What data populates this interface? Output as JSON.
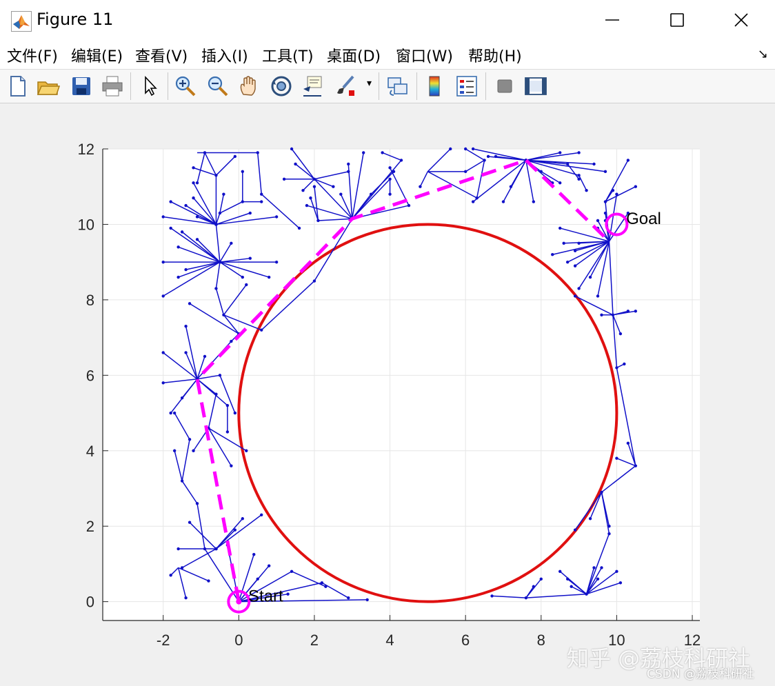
{
  "window": {
    "title": "Figure 11",
    "controls": {
      "minimize": "minimize-icon",
      "maximize": "maximize-icon",
      "close": "close-icon"
    }
  },
  "menu": [
    "文件(F)",
    "编辑(E)",
    "查看(V)",
    "插入(I)",
    "工具(T)",
    "桌面(D)",
    "窗口(W)",
    "帮助(H)"
  ],
  "toolbar": [
    "new-figure-icon",
    "open-file-icon",
    "save-icon",
    "print-icon",
    "pointer-icon",
    "zoom-in-icon",
    "zoom-out-icon",
    "pan-icon",
    "rotate-3d-icon",
    "data-cursor-icon",
    "brush-icon",
    "link-plot-icon",
    "colorbar-icon",
    "legend-icon",
    "hide-plot-tools-icon",
    "show-plot-tools-icon"
  ],
  "colors": {
    "tree": "#1010c8",
    "path": "#ff00ff",
    "obstacle": "#e01010",
    "grid": "#e6e6e6"
  },
  "chart_data": {
    "type": "line",
    "xlim": [
      -3.6,
      12.2
    ],
    "ylim": [
      -0.5,
      12
    ],
    "xticks": [
      "-2",
      "0",
      "2",
      "4",
      "6",
      "8",
      "10",
      "12"
    ],
    "yticks": [
      "0",
      "2",
      "4",
      "6",
      "8",
      "10",
      "12"
    ],
    "grid": true,
    "annotations": [
      {
        "text": "Start",
        "x": 0.25,
        "y": 0.15
      },
      {
        "text": "Goal",
        "x": 10.25,
        "y": 10.15
      }
    ],
    "start": {
      "x": 0,
      "y": 0
    },
    "goal": {
      "x": 10,
      "y": 10
    },
    "obstacle_circle": {
      "cx": 5,
      "cy": 5,
      "r": 5
    },
    "path": [
      {
        "x": 0,
        "y": 0
      },
      {
        "x": -1.1,
        "y": 5.9
      },
      {
        "x": 3.0,
        "y": 10.15
      },
      {
        "x": 7.6,
        "y": 11.7
      },
      {
        "x": 9.8,
        "y": 9.55
      }
    ],
    "tree_edges": [
      [
        0,
        0,
        -0.9,
        1.4
      ],
      [
        0,
        0,
        0.5,
        0.6
      ],
      [
        0,
        0,
        0.8,
        0.95
      ],
      [
        0,
        0,
        1.4,
        0.8
      ],
      [
        0,
        0,
        2.2,
        0.5
      ],
      [
        0,
        0,
        3.4,
        0.05
      ],
      [
        0,
        0,
        1.3,
        0.2
      ],
      [
        0,
        0,
        0.4,
        1.25
      ],
      [
        0,
        0,
        -0.3,
        1.5
      ],
      [
        1.4,
        0.8,
        2.3,
        0.4
      ],
      [
        2.2,
        0.5,
        2.9,
        0.1
      ],
      [
        -0.6,
        1.4,
        -1.5,
        0.9
      ],
      [
        -0.6,
        1.4,
        -1.3,
        2.1
      ],
      [
        -0.6,
        1.4,
        -1.6,
        1.4
      ],
      [
        -0.6,
        1.4,
        0.1,
        2.2
      ],
      [
        -0.6,
        1.4,
        0.6,
        2.3
      ],
      [
        -0.6,
        1.4,
        -0.1,
        1.9
      ],
      [
        -1.6,
        0.9,
        -1.4,
        0.1
      ],
      [
        -1.6,
        0.9,
        -1.8,
        0.7
      ],
      [
        -1.6,
        0.9,
        -0.8,
        0.55
      ],
      [
        -0.9,
        1.4,
        -1.1,
        2.6
      ],
      [
        -1.1,
        2.6,
        -1.5,
        3.2
      ],
      [
        -1.5,
        3.2,
        -1.7,
        4.0
      ],
      [
        -1.5,
        3.2,
        -1.3,
        4.3
      ],
      [
        -1.3,
        4.3,
        -1.7,
        5.0
      ],
      [
        -1.1,
        5.9,
        -1.8,
        5.0
      ],
      [
        -1.1,
        5.9,
        -2.0,
        5.8
      ],
      [
        -1.1,
        5.9,
        -2.0,
        6.6
      ],
      [
        -1.1,
        5.9,
        -1.4,
        6.6
      ],
      [
        -1.1,
        5.9,
        -1.4,
        7.3
      ],
      [
        -1.1,
        5.9,
        -0.3,
        5.2
      ],
      [
        -1.1,
        5.9,
        -0.5,
        6.0
      ],
      [
        -1.1,
        5.9,
        -1.5,
        5.4
      ],
      [
        -1.1,
        5.9,
        -0.9,
        6.5
      ],
      [
        -1.1,
        5.9,
        -0.6,
        5.5
      ],
      [
        -0.5,
        6.0,
        -0.1,
        5.0
      ],
      [
        -0.3,
        5.2,
        -0.3,
        4.5
      ],
      [
        -0.6,
        5.5,
        -0.8,
        4.6
      ],
      [
        -0.8,
        4.6,
        -1.2,
        4.0
      ],
      [
        -0.8,
        4.6,
        -0.2,
        3.6
      ],
      [
        -0.8,
        4.6,
        0.2,
        4.0
      ],
      [
        -1.1,
        5.9,
        -0.2,
        6.9
      ],
      [
        -0.2,
        6.9,
        0.0,
        7.1
      ],
      [
        0.0,
        7.1,
        -1.3,
        7.9
      ],
      [
        0.0,
        7.1,
        -0.4,
        7.6
      ],
      [
        -0.4,
        7.6,
        -0.6,
        8.3
      ],
      [
        -0.4,
        7.6,
        0.6,
        7.2
      ],
      [
        -0.6,
        8.3,
        -0.5,
        9.0
      ],
      [
        -0.4,
        7.6,
        0.2,
        8.4
      ],
      [
        0.6,
        7.2,
        2.0,
        8.5
      ],
      [
        2.0,
        8.5,
        3.0,
        10.15
      ],
      [
        -0.5,
        9.0,
        -2.0,
        8.1
      ],
      [
        -0.5,
        9.0,
        -2.0,
        9.0
      ],
      [
        -0.5,
        9.0,
        -1.6,
        9.4
      ],
      [
        -0.5,
        9.0,
        -1.8,
        9.9
      ],
      [
        -0.5,
        9.0,
        -1.5,
        9.8
      ],
      [
        -0.5,
        9.0,
        -1.4,
        8.8
      ],
      [
        -0.5,
        9.0,
        -1.1,
        9.6
      ],
      [
        -0.5,
        9.0,
        -0.2,
        9.5
      ],
      [
        -0.5,
        9.0,
        0.1,
        8.6
      ],
      [
        -0.5,
        9.0,
        0.8,
        8.6
      ],
      [
        -0.5,
        9.0,
        1.0,
        9.0
      ],
      [
        -0.5,
        9.0,
        0.3,
        9.1
      ],
      [
        -0.5,
        9.0,
        -1.6,
        8.6
      ],
      [
        -0.5,
        9.0,
        -0.6,
        10.0
      ],
      [
        -0.6,
        10.0,
        -0.5,
        10.3
      ],
      [
        -0.6,
        10.0,
        -1.8,
        10.6
      ],
      [
        -0.6,
        10.0,
        -1.2,
        10.7
      ],
      [
        -0.6,
        10.0,
        -1.4,
        10.5
      ],
      [
        -0.6,
        10.0,
        -1.1,
        10.2
      ],
      [
        -0.6,
        10.0,
        -0.6,
        11.3
      ],
      [
        -0.6,
        10.0,
        -1.2,
        11.1
      ],
      [
        -0.6,
        10.0,
        -2.0,
        10.2
      ],
      [
        -0.6,
        10.0,
        0.3,
        10.3
      ],
      [
        -0.6,
        10.0,
        1.0,
        10.2
      ],
      [
        -0.5,
        10.3,
        0.1,
        10.6
      ],
      [
        -0.5,
        10.3,
        -0.4,
        10.8
      ],
      [
        -0.6,
        11.3,
        -1.2,
        11.5
      ],
      [
        -0.6,
        11.3,
        -0.9,
        11.9
      ],
      [
        -0.6,
        11.3,
        -0.1,
        11.8
      ],
      [
        0.1,
        10.6,
        0.1,
        11.4
      ],
      [
        0.1,
        10.6,
        0.6,
        10.6
      ],
      [
        -1.1,
        11.9,
        0.5,
        11.9
      ],
      [
        0.5,
        11.9,
        0.6,
        10.8
      ],
      [
        0.6,
        10.8,
        1.6,
        9.9
      ],
      [
        -0.9,
        11.9,
        -1.1,
        11.1
      ],
      [
        3.0,
        10.15,
        2.0,
        11.2
      ],
      [
        3.0,
        10.15,
        1.8,
        10.5
      ],
      [
        3.0,
        10.15,
        2.1,
        10.1
      ],
      [
        3.0,
        10.15,
        3.3,
        11.9
      ],
      [
        3.0,
        10.15,
        4.0,
        11.2
      ],
      [
        3.0,
        10.15,
        3.5,
        10.8
      ],
      [
        3.0,
        10.15,
        4.5,
        10.5
      ],
      [
        3.0,
        10.15,
        4.3,
        11.7
      ],
      [
        3.0,
        10.15,
        2.7,
        10.8
      ],
      [
        3.0,
        10.15,
        2.9,
        11.6
      ],
      [
        2.0,
        11.2,
        1.5,
        11.6
      ],
      [
        2.0,
        11.2,
        1.2,
        11.2
      ],
      [
        2.0,
        11.2,
        1.7,
        10.9
      ],
      [
        2.0,
        11.2,
        2.5,
        11.0
      ],
      [
        2.0,
        11.2,
        2.9,
        11.4
      ],
      [
        2.0,
        11.2,
        1.4,
        12.0
      ],
      [
        2.1,
        10.1,
        1.9,
        10.7
      ],
      [
        2.1,
        10.1,
        2.0,
        11.0
      ],
      [
        3.5,
        10.8,
        4.1,
        11.4
      ],
      [
        4.0,
        11.2,
        4.0,
        10.8
      ],
      [
        4.5,
        10.5,
        4.0,
        11.5
      ],
      [
        4.3,
        11.7,
        3.8,
        11.9
      ],
      [
        5.0,
        11.4,
        6.0,
        11.4
      ],
      [
        5.0,
        11.4,
        5.6,
        12.0
      ],
      [
        5.0,
        11.4,
        6.3,
        10.7
      ],
      [
        5.0,
        11.4,
        4.8,
        11.0
      ],
      [
        6.0,
        11.4,
        6.5,
        11.7
      ],
      [
        6.5,
        11.7,
        6.0,
        12.0
      ],
      [
        6.5,
        11.7,
        6.3,
        10.7
      ],
      [
        7.6,
        11.7,
        6.2,
        12.0
      ],
      [
        7.6,
        11.7,
        6.8,
        11.8
      ],
      [
        7.6,
        11.7,
        8.0,
        11.4
      ],
      [
        7.6,
        11.7,
        8.5,
        11.9
      ],
      [
        7.6,
        11.7,
        8.7,
        11.6
      ],
      [
        7.6,
        11.7,
        9.0,
        11.3
      ],
      [
        7.6,
        11.7,
        9.7,
        11.4
      ],
      [
        7.6,
        11.7,
        8.3,
        11.1
      ],
      [
        7.6,
        11.7,
        7.8,
        10.6
      ],
      [
        7.6,
        11.7,
        7.0,
        10.6
      ],
      [
        7.6,
        11.7,
        6.2,
        10.6
      ],
      [
        7.6,
        11.7,
        7.2,
        11.0
      ],
      [
        7.6,
        11.7,
        6.6,
        11.8
      ],
      [
        7.6,
        11.7,
        9.0,
        11.9
      ],
      [
        7.6,
        11.7,
        9.4,
        11.6
      ],
      [
        8.7,
        11.6,
        9.0,
        11.2
      ],
      [
        9.0,
        11.3,
        9.2,
        10.9
      ],
      [
        8.0,
        11.4,
        8.5,
        11.1
      ],
      [
        9.8,
        9.55,
        8.3,
        9.2
      ],
      [
        9.8,
        9.55,
        8.9,
        9.3
      ],
      [
        9.8,
        9.55,
        9.0,
        9.5
      ],
      [
        9.8,
        9.55,
        8.9,
        8.9
      ],
      [
        9.8,
        9.55,
        8.6,
        9.5
      ],
      [
        9.8,
        9.55,
        9.3,
        8.6
      ],
      [
        9.8,
        9.55,
        9.5,
        8.1
      ],
      [
        9.8,
        9.55,
        9.0,
        8.3
      ],
      [
        9.8,
        9.55,
        8.7,
        9.0
      ],
      [
        9.8,
        9.55,
        9.5,
        9.9
      ],
      [
        9.8,
        9.55,
        9.7,
        10.3
      ],
      [
        9.8,
        9.55,
        10.0,
        10.8
      ],
      [
        9.8,
        9.55,
        10.3,
        10.3
      ],
      [
        9.8,
        9.55,
        9.5,
        10.1
      ],
      [
        9.8,
        9.55,
        9.7,
        10.6
      ],
      [
        9.8,
        9.55,
        8.5,
        9.9
      ],
      [
        9.8,
        9.55,
        9.7,
        10.1
      ],
      [
        9.7,
        10.6,
        10.5,
        11.0
      ],
      [
        9.7,
        10.6,
        10.3,
        11.7
      ],
      [
        9.7,
        10.6,
        9.9,
        10.9
      ],
      [
        9.8,
        9.55,
        9.9,
        7.6
      ],
      [
        9.9,
        7.6,
        8.9,
        8.1
      ],
      [
        9.9,
        7.6,
        9.6,
        7.6
      ],
      [
        9.9,
        7.6,
        10.3,
        7.7
      ],
      [
        9.9,
        7.6,
        10.5,
        7.7
      ],
      [
        9.9,
        7.6,
        10.1,
        7.1
      ],
      [
        9.9,
        7.6,
        10.0,
        6.2
      ],
      [
        10.0,
        6.2,
        10.2,
        6.3
      ],
      [
        10.0,
        6.2,
        10.5,
        3.6
      ],
      [
        10.5,
        3.6,
        10.0,
        3.8
      ],
      [
        10.5,
        3.6,
        10.3,
        4.2
      ],
      [
        10.5,
        3.6,
        9.6,
        2.9
      ],
      [
        9.6,
        2.9,
        8.9,
        1.9
      ],
      [
        9.6,
        2.9,
        9.8,
        2.0
      ],
      [
        9.6,
        2.9,
        9.3,
        2.2
      ],
      [
        9.6,
        2.9,
        9.8,
        1.8
      ],
      [
        9.8,
        1.8,
        9.2,
        0.2
      ],
      [
        9.2,
        0.2,
        8.7,
        0.6
      ],
      [
        9.2,
        0.2,
        8.5,
        0.8
      ],
      [
        9.2,
        0.2,
        9.4,
        0.9
      ],
      [
        9.2,
        0.2,
        10.0,
        0.8
      ],
      [
        9.2,
        0.2,
        10.1,
        0.5
      ],
      [
        9.2,
        0.2,
        8.8,
        0.4
      ],
      [
        9.2,
        0.2,
        7.6,
        0.1
      ],
      [
        7.6,
        0.1,
        7.8,
        0.4
      ],
      [
        7.6,
        0.1,
        8.0,
        0.6
      ],
      [
        7.6,
        0.1,
        6.7,
        0.15
      ],
      [
        9.2,
        0.2,
        9.5,
        0.6
      ],
      [
        9.2,
        0.2,
        9.6,
        0.9
      ]
    ],
    "tree_nodes": [
      [
        -1.1,
        5.9
      ],
      [
        3.0,
        10.15
      ],
      [
        7.6,
        11.7
      ],
      [
        -0.5,
        9.0
      ],
      [
        -0.6,
        10.0
      ],
      [
        -0.6,
        1.4
      ]
    ]
  }
}
